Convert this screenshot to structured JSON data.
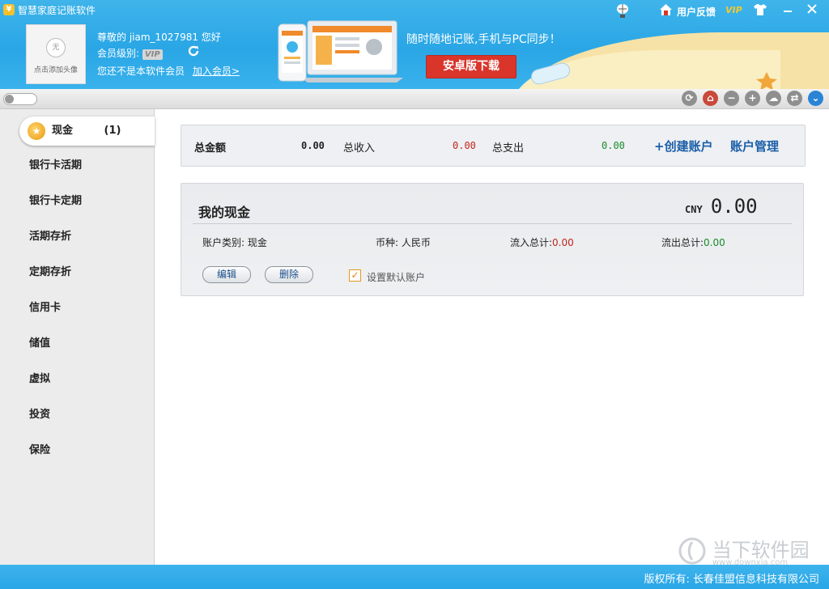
{
  "app": {
    "title": "智慧家庭记账软件"
  },
  "user": {
    "greeting": "尊敬的 jiam_1027981 您好",
    "level_label": "会员级别:",
    "level_badge": "VIP",
    "not_member": "您还不是本软件会员",
    "join_link": "加入会员>",
    "avatar_placeholder": "无",
    "avatar_hint": "点击添加头像"
  },
  "promo": {
    "text": "随时随地记账,手机与PC同步！",
    "download_button": "安卓版下载"
  },
  "topbar": {
    "feedback": "用户反馈",
    "vip": "VIP"
  },
  "sidebar": {
    "active": {
      "label": "现金",
      "count": "(1)"
    },
    "items": [
      "银行卡活期",
      "银行卡定期",
      "活期存折",
      "定期存折",
      "信用卡",
      "储值",
      "虚拟",
      "投资",
      "保险"
    ]
  },
  "summary": {
    "total_label": "总金额",
    "total_value": "0.00",
    "income_label": "总收入",
    "income_value": "0.00",
    "expense_label": "总支出",
    "expense_value": "0.00",
    "create_account": "+创建账户",
    "manage_account": "账户管理"
  },
  "account": {
    "title": "我的现金",
    "currency_code": "CNY",
    "balance": "0.00",
    "type_label": "账户类别:",
    "type_value": "现金",
    "currency_label": "币种:",
    "currency_value": "人民币",
    "inflow_label": "流入总计:",
    "inflow_value": "0.00",
    "outflow_label": "流出总计:",
    "outflow_value": "0.00",
    "edit_button": "编辑",
    "delete_button": "删除",
    "default_checkbox": "设置默认账户",
    "default_checked": true
  },
  "footer": {
    "copyright": "版权所有: 长春佳盟信息科技有限公司"
  },
  "watermark": {
    "text": "当下软件园",
    "sub": "www.downxia.com"
  },
  "colors": {
    "brand": "#2aa6e6",
    "download": "#d9352b",
    "income": "#c0261f",
    "expense": "#1a8a2a",
    "link": "#1c5fa8"
  }
}
